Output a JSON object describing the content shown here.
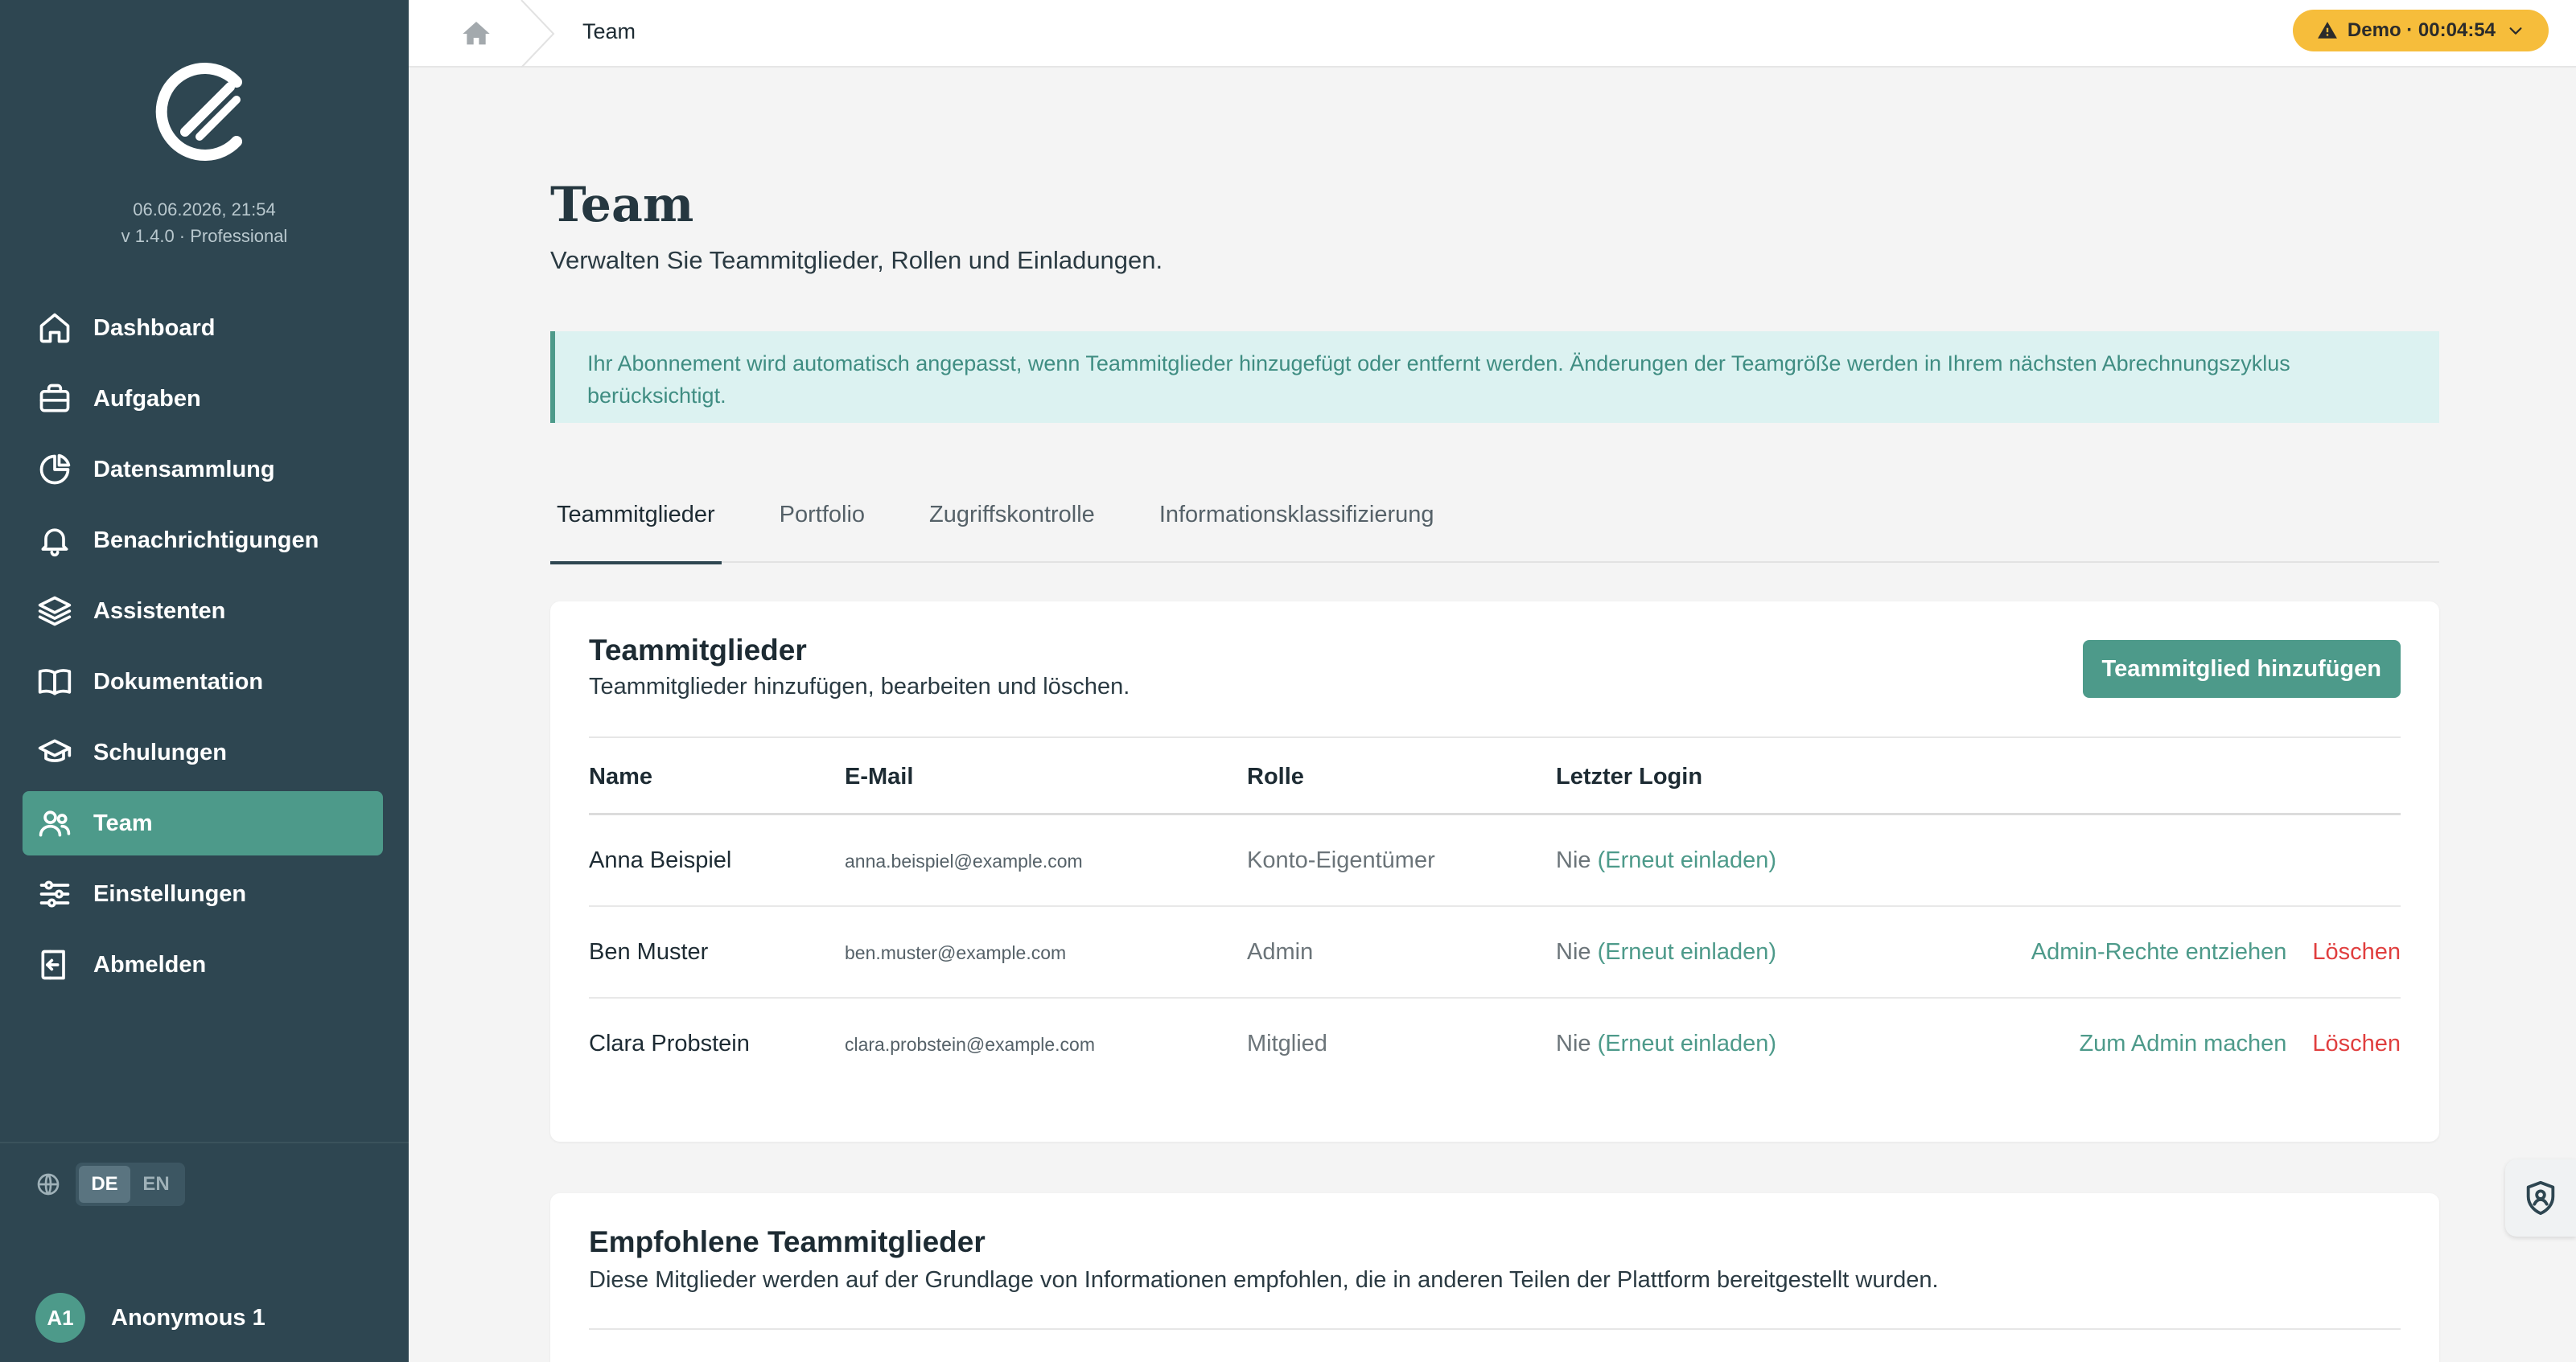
{
  "sidebar": {
    "datetime": "06.06.2026, 21:54",
    "version": "v 1.4.0 · Professional",
    "items": [
      {
        "label": "Dashboard",
        "icon": "home-icon"
      },
      {
        "label": "Aufgaben",
        "icon": "briefcase-icon"
      },
      {
        "label": "Datensammlung",
        "icon": "pie-chart-icon"
      },
      {
        "label": "Benachrichtigungen",
        "icon": "bell-icon"
      },
      {
        "label": "Assistenten",
        "icon": "layers-icon"
      },
      {
        "label": "Dokumentation",
        "icon": "book-icon"
      },
      {
        "label": "Schulungen",
        "icon": "graduation-cap-icon"
      },
      {
        "label": "Team",
        "icon": "users-icon",
        "active": true
      },
      {
        "label": "Einstellungen",
        "icon": "sliders-icon"
      },
      {
        "label": "Abmelden",
        "icon": "logout-icon"
      }
    ],
    "languages": [
      "DE",
      "EN"
    ],
    "active_language": "DE",
    "user": {
      "initials": "A1",
      "name": "Anonymous 1"
    }
  },
  "topbar": {
    "breadcrumb": "Team",
    "demo_label": "Demo · 00:04:54"
  },
  "page": {
    "title": "Team",
    "subtitle": "Verwalten Sie Teammitglieder, Rollen und Einladungen.",
    "alert": "Ihr Abonnement wird automatisch angepasst, wenn Teammitglieder hinzugefügt oder entfernt werden. Änderungen der Teamgröße werden in Ihrem nächsten Abrechnungszyklus berücksichtigt."
  },
  "tabs": [
    "Teammitglieder",
    "Portfolio",
    "Zugriffskontrolle",
    "Informationsklassifizierung"
  ],
  "members": {
    "title": "Teammitglieder",
    "subtitle": "Teammitglieder hinzufügen, bearbeiten und löschen.",
    "add_button": "Teammitglied hinzufügen",
    "columns": [
      "Name",
      "E-Mail",
      "Rolle",
      "Letzter Login"
    ],
    "rows": [
      {
        "name": "Anna Beispiel",
        "email": "anna.beispiel@example.com",
        "role": "Konto-Eigentümer",
        "login": "Nie",
        "invite": "(Erneut einladen)",
        "admin_action": "",
        "delete": ""
      },
      {
        "name": "Ben Muster",
        "email": "ben.muster@example.com",
        "role": "Admin",
        "login": "Nie",
        "invite": "(Erneut einladen)",
        "admin_action": "Admin-Rechte entziehen",
        "delete": "Löschen"
      },
      {
        "name": "Clara Probstein",
        "email": "clara.probstein@example.com",
        "role": "Mitglied",
        "login": "Nie",
        "invite": "(Erneut einladen)",
        "admin_action": "Zum Admin machen",
        "delete": "Löschen"
      }
    ]
  },
  "recommended": {
    "title": "Empfohlene Teammitglieder",
    "subtitle": "Diese Mitglieder werden auf der Grundlage von Informationen empfohlen, die in anderen Teilen der Plattform bereitgestellt wurden."
  },
  "colors": {
    "sidebar_bg": "#2e4651",
    "accent": "#4d9a8a",
    "danger": "#e03e3e",
    "demo_badge": "#f6bd3b"
  }
}
